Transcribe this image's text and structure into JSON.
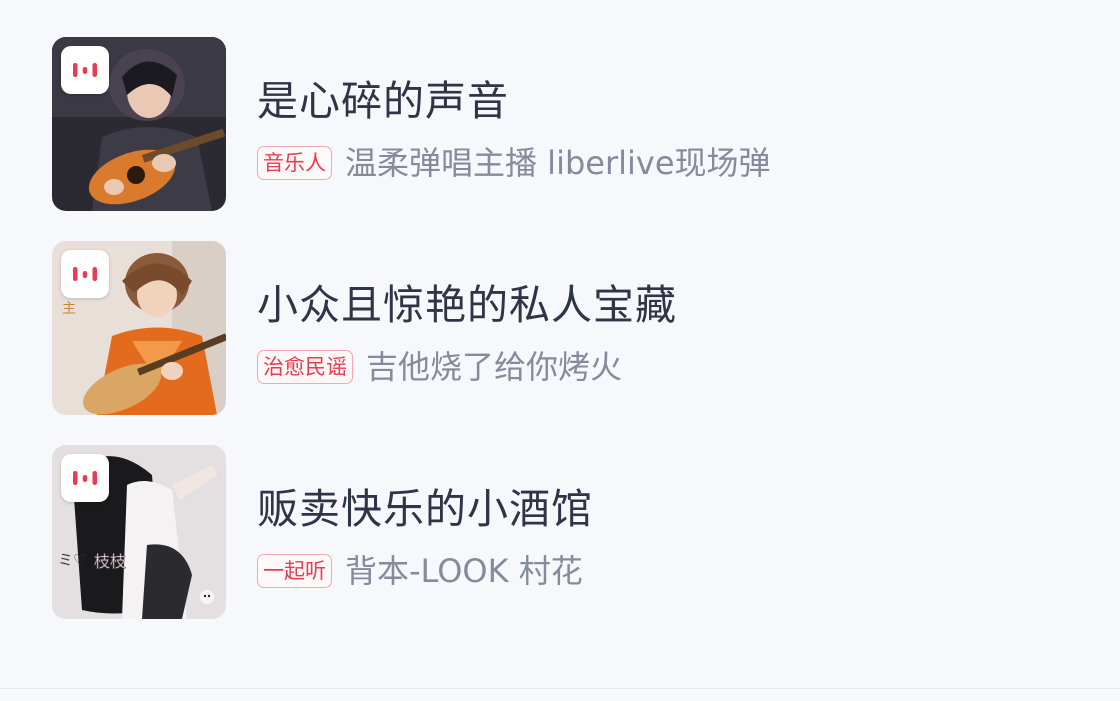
{
  "colors": {
    "background": "#f7f8fc",
    "title": "#2f3447",
    "description": "#858b9b",
    "tag_border": "#f3a7ae",
    "tag_text": "#ea3c4f",
    "badge_logo": "#e83c55"
  },
  "playlists": [
    {
      "title": "是心碎的声音",
      "tag": "音乐人",
      "description": "温柔弹唱主播 liberlive现场弹",
      "cover_icon": "music-app-logo-icon"
    },
    {
      "title": "小众且惊艳的私人宝藏",
      "tag": "治愈民谣",
      "description": "吉他烧了给你烤火",
      "cover_icon": "music-app-logo-icon"
    },
    {
      "title": "贩卖快乐的小酒馆",
      "tag": "一起听",
      "description": "背本-LOOK 村花",
      "cover_icon": "music-app-logo-icon"
    }
  ]
}
